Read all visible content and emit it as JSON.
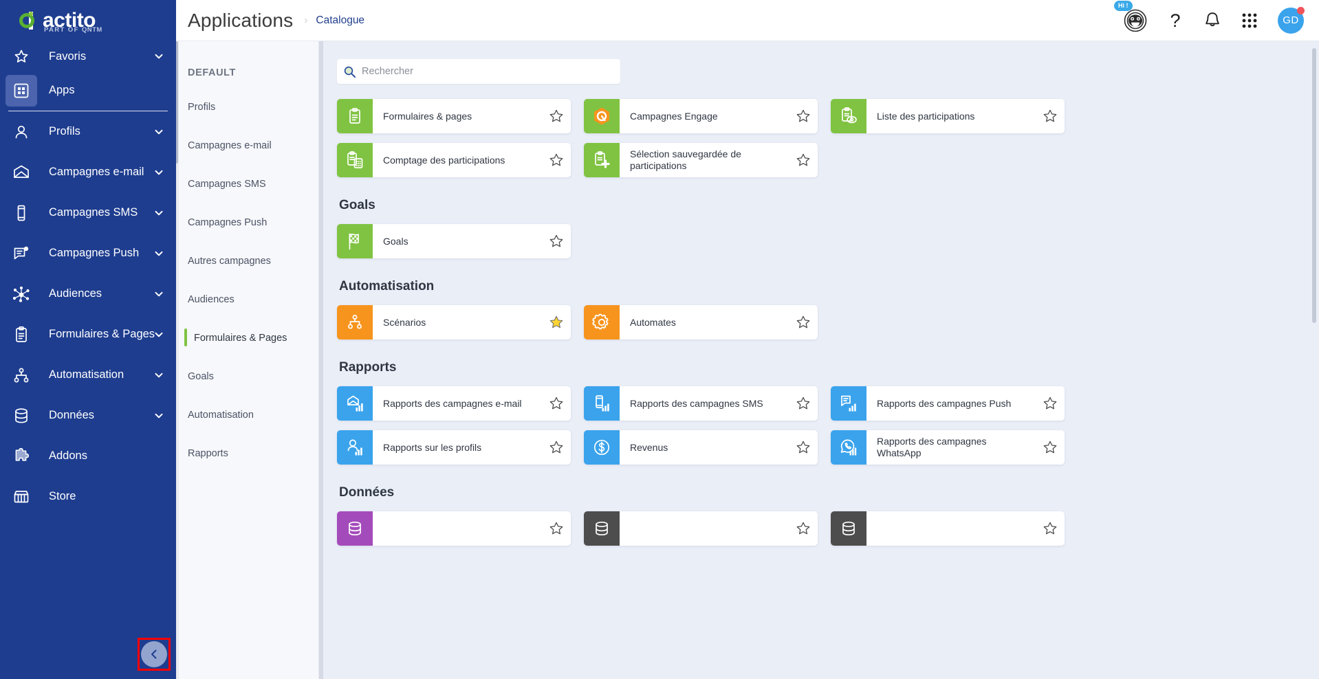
{
  "brand": {
    "name": "actito",
    "tagline_prefix": "PART OF",
    "tagline_brand": "QNTM"
  },
  "leftnav": {
    "items": [
      {
        "label": "Favoris",
        "icon": "star-icon",
        "chevron": true,
        "active": false
      },
      {
        "label": "Apps",
        "icon": "apps-grid-icon",
        "chevron": false,
        "active": true
      },
      {
        "label": "Profils",
        "icon": "user-icon",
        "chevron": true,
        "active": false
      },
      {
        "label": "Campagnes e-mail",
        "icon": "envelope-icon",
        "chevron": true,
        "active": false
      },
      {
        "label": "Campagnes SMS",
        "icon": "mobile-icon",
        "chevron": true,
        "active": false
      },
      {
        "label": "Campagnes Push",
        "icon": "push-message-icon",
        "chevron": true,
        "active": false
      },
      {
        "label": "Audiences",
        "icon": "network-nodes-icon",
        "chevron": true,
        "active": false
      },
      {
        "label": "Formulaires & Pages",
        "icon": "clipboard-icon",
        "chevron": true,
        "active": false
      },
      {
        "label": "Automatisation",
        "icon": "sitemap-icon",
        "chevron": true,
        "active": false
      },
      {
        "label": "Données",
        "icon": "database-icon",
        "chevron": true,
        "active": false
      },
      {
        "label": "Addons",
        "icon": "puzzle-icon",
        "chevron": false,
        "active": false
      },
      {
        "label": "Store",
        "icon": "store-icon",
        "chevron": false,
        "active": false
      }
    ],
    "collapse_button": "collapse-sidebar-button"
  },
  "topbar": {
    "title": "Applications",
    "breadcrumb_separator": "›",
    "breadcrumb_link": "Catalogue",
    "assistant_badge": "Hi !",
    "assistant_icon": "chatbot-face-icon",
    "help_icon": "question-mark-icon",
    "notifications_icon": "bell-icon",
    "app_switcher_icon": "grid-dots-icon",
    "avatar_initials": "GD",
    "avatar_has_alert": true
  },
  "catalogue": {
    "header": "DEFAULT",
    "items": [
      {
        "label": "Profils",
        "active": false
      },
      {
        "label": "Campagnes e-mail",
        "active": false
      },
      {
        "label": "Campagnes SMS",
        "active": false
      },
      {
        "label": "Campagnes Push",
        "active": false
      },
      {
        "label": "Autres campagnes",
        "active": false
      },
      {
        "label": "Audiences",
        "active": false
      },
      {
        "label": "Formulaires & Pages",
        "active": true
      },
      {
        "label": "Goals",
        "active": false
      },
      {
        "label": "Automatisation",
        "active": false
      },
      {
        "label": "Rapports",
        "active": false
      }
    ]
  },
  "search": {
    "placeholder": "Rechercher",
    "value": "",
    "icon": "search-icon"
  },
  "colors": {
    "nav_blue": "#1e3d8f",
    "accent_green": "#80c342",
    "accent_orange": "#f7941e",
    "accent_blue": "#3aa3ec",
    "accent_purple": "#a44bbb",
    "accent_dark": "#4d4d4d",
    "star_filled": "#ffd534",
    "highlight_red": "#ff0000"
  },
  "sections": [
    {
      "title": "",
      "show_title": false,
      "cards": [
        {
          "label": "Formulaires & pages",
          "color": "#80c342",
          "icon": "clipboard-icon",
          "starred": false
        },
        {
          "label": "Campagnes Engage",
          "color": "#80c342",
          "icon": "engage-hex-icon",
          "starred": false
        },
        {
          "label": "Liste des participations",
          "color": "#80c342",
          "icon": "clipboard-eye-icon",
          "starred": false
        },
        {
          "label": "Comptage des participations",
          "color": "#80c342",
          "icon": "clipboard-calc-icon",
          "starred": false
        },
        {
          "label": "Sélection sauvegardée de participations",
          "color": "#80c342",
          "icon": "clipboard-plus-icon",
          "starred": false
        }
      ]
    },
    {
      "title": "Goals",
      "show_title": true,
      "cards": [
        {
          "label": "Goals",
          "color": "#80c342",
          "icon": "checkered-flag-icon",
          "starred": false
        }
      ]
    },
    {
      "title": "Automatisation",
      "show_title": true,
      "cards": [
        {
          "label": "Scénarios",
          "color": "#f7941e",
          "icon": "sitemap-icon",
          "starred": true
        },
        {
          "label": "Automates",
          "color": "#f7941e",
          "icon": "gear-icon",
          "starred": false
        }
      ]
    },
    {
      "title": "Rapports",
      "show_title": true,
      "cards": [
        {
          "label": "Rapports des campagnes e-mail",
          "color": "#3aa3ec",
          "icon": "email-chart-icon",
          "starred": false
        },
        {
          "label": "Rapports des campagnes SMS",
          "color": "#3aa3ec",
          "icon": "sms-chart-icon",
          "starred": false
        },
        {
          "label": "Rapports des campagnes Push",
          "color": "#3aa3ec",
          "icon": "push-chart-icon",
          "starred": false
        },
        {
          "label": "Rapports sur les profils",
          "color": "#3aa3ec",
          "icon": "profile-chart-icon",
          "starred": false
        },
        {
          "label": "Revenus",
          "color": "#3aa3ec",
          "icon": "dollar-circle-icon",
          "starred": false
        },
        {
          "label": "Rapports des campagnes WhatsApp",
          "color": "#3aa3ec",
          "icon": "whatsapp-chart-icon",
          "starred": false
        }
      ]
    },
    {
      "title": "Données",
      "show_title": true,
      "cards": [
        {
          "label": "",
          "color": "#a44bbb",
          "icon": "data-icon",
          "starred": false
        },
        {
          "label": "",
          "color": "#4d4d4d",
          "icon": "data-icon",
          "starred": false
        },
        {
          "label": "",
          "color": "#4d4d4d",
          "icon": "data-icon",
          "starred": false
        }
      ]
    }
  ]
}
